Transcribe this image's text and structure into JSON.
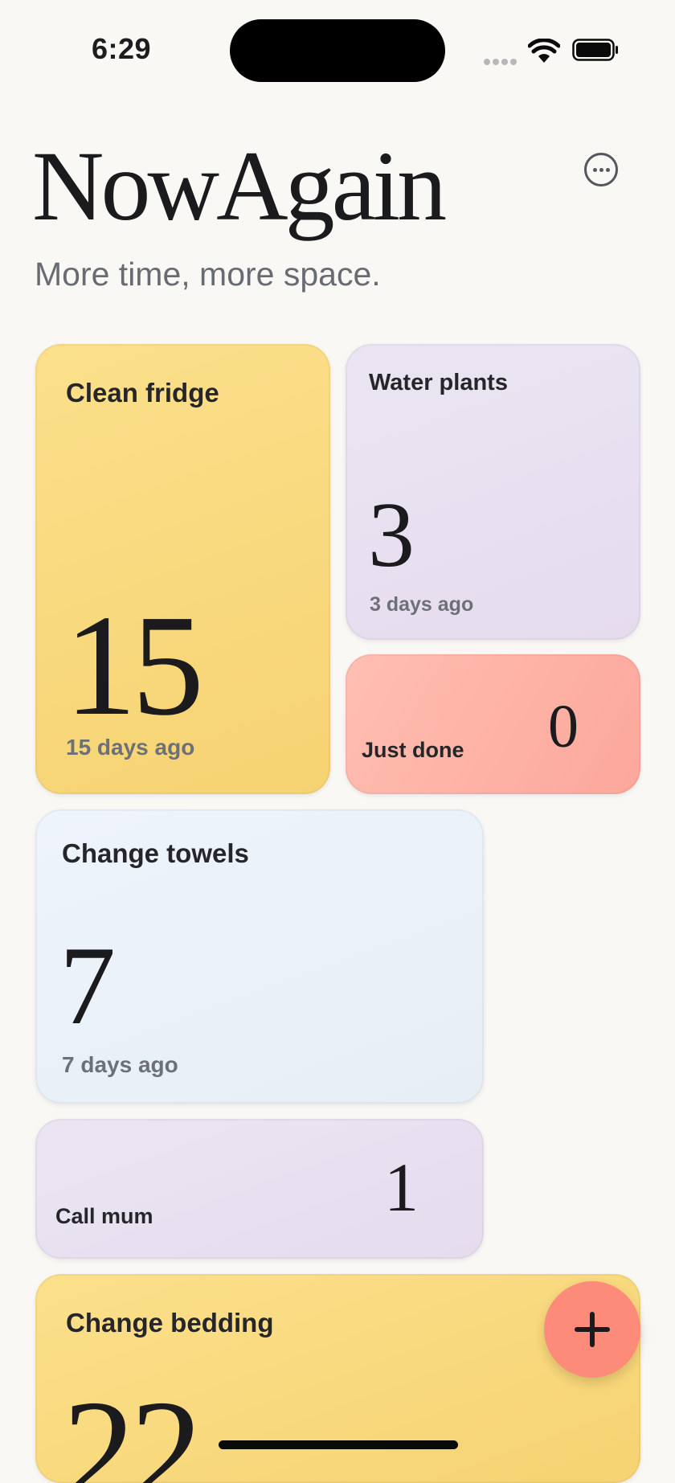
{
  "status_bar": {
    "time": "6:29"
  },
  "header": {
    "title": "NowAgain",
    "subtitle": "More time, more space.",
    "menu_icon": "ellipsis-circle-icon"
  },
  "tasks": [
    {
      "title": "Clean fridge",
      "count": "15",
      "ago": "15 days ago",
      "color": "#f9dc80"
    },
    {
      "title": "Water plants",
      "count": "3",
      "ago": "3 days ago",
      "color": "#e8e0f0"
    },
    {
      "title": "Just done",
      "count": "0",
      "color": "#fdb3a8"
    },
    {
      "title": "Change towels",
      "count": "7",
      "ago": "7 days ago",
      "color": "#ebf1f9"
    },
    {
      "title": "Call mum",
      "count": "1",
      "color": "#e8e0f0"
    },
    {
      "title": "Change bedding",
      "count": "22",
      "color": "#f9dc80"
    }
  ],
  "fab": {
    "icon": "plus-icon"
  }
}
